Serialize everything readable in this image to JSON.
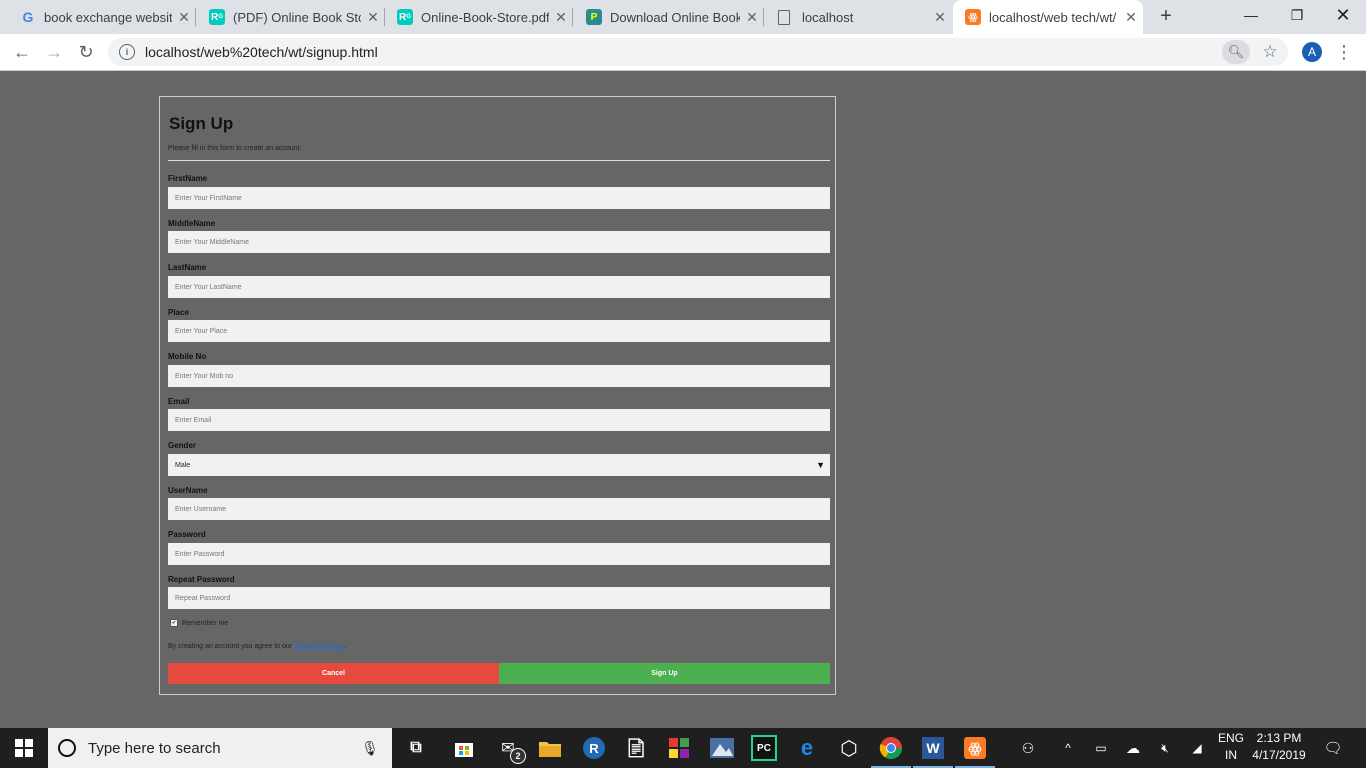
{
  "browser": {
    "tabs": [
      {
        "title": "book exchange website",
        "favicon": "google-icon"
      },
      {
        "title": "(PDF) Online Book Store",
        "favicon": "researchgate-icon"
      },
      {
        "title": "Online-Book-Store.pdf",
        "favicon": "researchgate-icon"
      },
      {
        "title": "Download Online Book",
        "favicon": "pdf-icon"
      },
      {
        "title": "localhost",
        "favicon": "document-icon"
      },
      {
        "title": "localhost/web tech/wt/",
        "favicon": "xampp-icon",
        "active": true
      }
    ],
    "url": "localhost/web%20tech/wt/signup.html",
    "profile_initial": "A"
  },
  "form": {
    "title": "Sign Up",
    "subtitle": "Please fill in this form to create an account.",
    "fields": [
      {
        "label": "FirstName",
        "placeholder": "Enter Your FirstName"
      },
      {
        "label": "MiddleName",
        "placeholder": "Enter Your MiddleName"
      },
      {
        "label": "LastName",
        "placeholder": "Enter Your LastName"
      },
      {
        "label": "Place",
        "placeholder": "Enter Your Place"
      },
      {
        "label": "Mobile No",
        "placeholder": "Enter Your Mob no"
      },
      {
        "label": "Email",
        "placeholder": "Enter Email"
      },
      {
        "label": "Gender",
        "value": "Male"
      },
      {
        "label": "UserName",
        "placeholder": "Enter Username"
      },
      {
        "label": "Password",
        "placeholder": "Enter Password"
      },
      {
        "label": "Repeat Password",
        "placeholder": "Repeat Password"
      }
    ],
    "remember_label": "Remember me",
    "remember_checked": true,
    "terms_prefix": "By creating an account you agree to our ",
    "terms_link": "Terms & Privacy",
    "terms_suffix": ".",
    "cancel_label": "Cancel",
    "signup_label": "Sign Up"
  },
  "taskbar": {
    "search_placeholder": "Type here to search",
    "mail_badge": "2",
    "language": "ENG",
    "region": "IN",
    "time": "2:13 PM",
    "date": "4/17/2019"
  },
  "colors": {
    "page_bg": "#666666",
    "cancel": "#e64a3e",
    "signup": "#4caf50",
    "link": "#1e6fcf"
  }
}
